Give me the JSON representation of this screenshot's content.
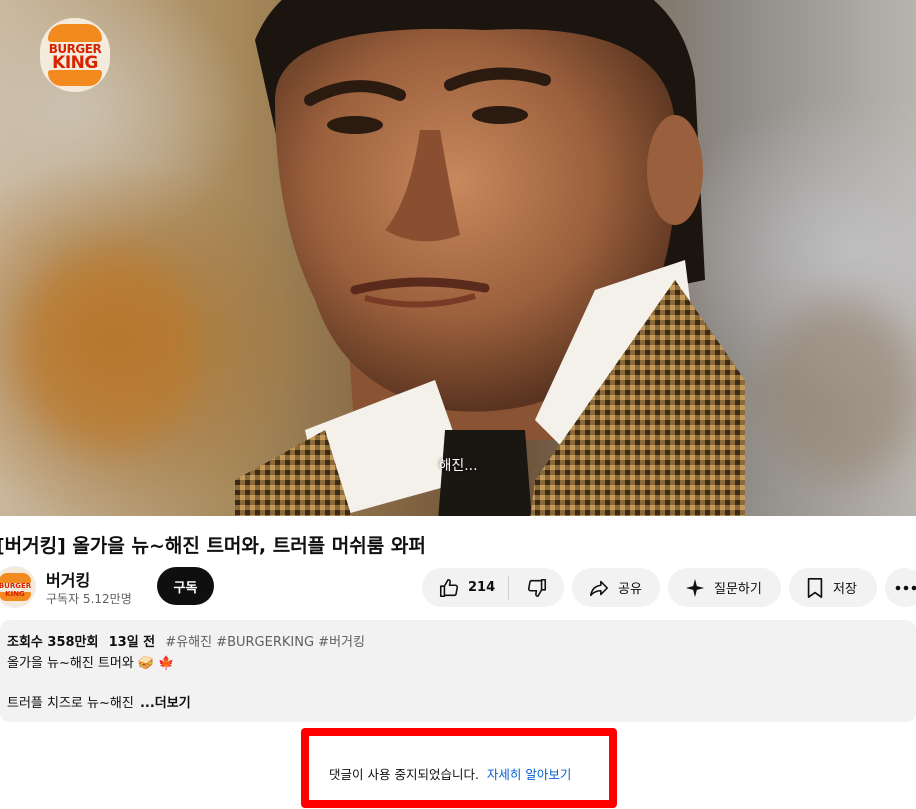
{
  "video": {
    "logo": {
      "line1": "BURGER",
      "line2": "KING"
    },
    "caption": "해진..."
  },
  "title": "[버거킹] 올가을 뉴~해진 트머와, 트러플 머쉬룸 와퍼",
  "channel": {
    "name": "버거킹",
    "subscribers": "구독자 5.12만명",
    "subscribe_label": "구독"
  },
  "actions": {
    "like_count": "214",
    "share_label": "공유",
    "ask_label": "질문하기",
    "save_label": "저장"
  },
  "description": {
    "views": "조회수 358만회",
    "date": "13일 전",
    "tags": "#유해진 #BURGERKING #버거킹",
    "line1": "올가을 뉴~해진 트머와 🥪 🍁",
    "line2": "트러플 치즈로 뉴~해진",
    "more_label": "...더보기"
  },
  "comments": {
    "disabled_text": "댓글이 사용 중지되었습니다.",
    "learn_more_label": "자세히 알아보기"
  },
  "colors": {
    "accent_red": "#ff0000",
    "link_blue": "#065fd4",
    "pill_bg": "#f2f2f2",
    "brand_orange": "#f28a1f",
    "brand_red": "#d62300"
  }
}
